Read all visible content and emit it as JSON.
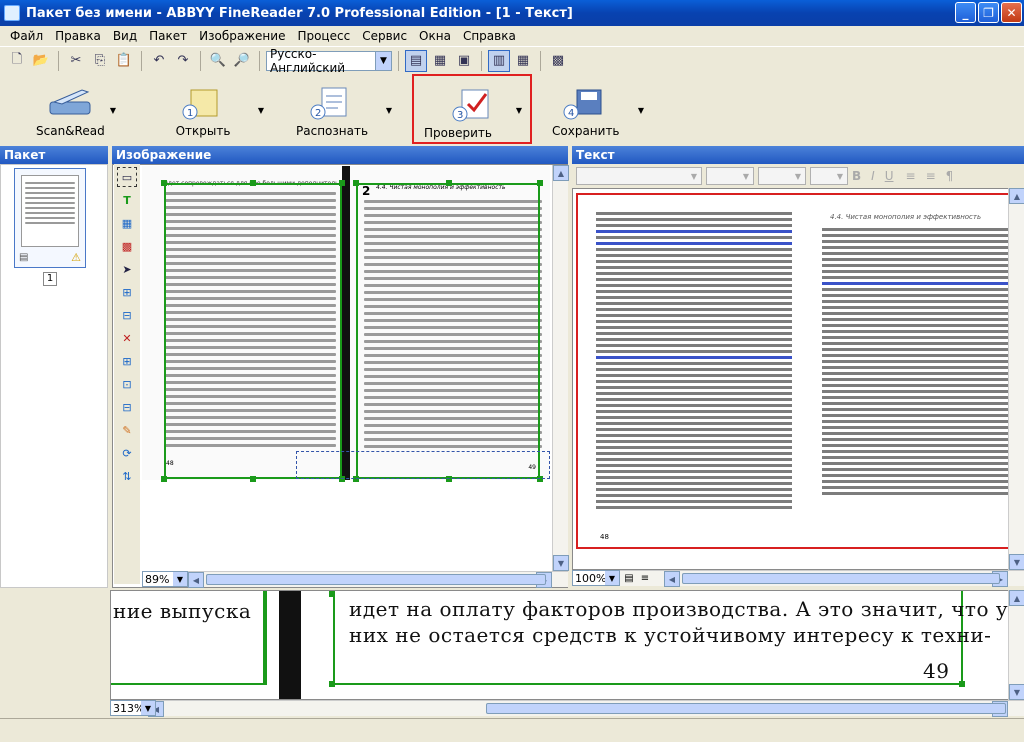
{
  "window": {
    "title": "Пакет без имени - ABBYY FineReader 7.0 Professional Edition - [1 - Текст]"
  },
  "menu": [
    "Файл",
    "Правка",
    "Вид",
    "Пакет",
    "Изображение",
    "Процесс",
    "Сервис",
    "Окна",
    "Справка"
  ],
  "toolbar": {
    "language": "Русско-Английский"
  },
  "bigbuttons": [
    {
      "label": "Scan&Read"
    },
    {
      "label": "Открыть",
      "num": "1"
    },
    {
      "label": "Распознать",
      "num": "2"
    },
    {
      "label": "Проверить",
      "num": "3"
    },
    {
      "label": "Сохранить",
      "num": "4"
    }
  ],
  "panes": {
    "batch": "Пакет",
    "image": "Изображение",
    "text": "Текст"
  },
  "thumb": {
    "page_num": "1"
  },
  "zoom": {
    "image": "89%",
    "text": "100%",
    "zoomview": "313%"
  },
  "image_pages": {
    "left_header": "идет сопровождаться для нее большими дополнительны-",
    "right_header": "4.4. Чистая монополия и эффективность",
    "right_chapter": "2",
    "left_page_num": "48",
    "right_page_num": "49"
  },
  "text_page": {
    "header": "4.4. Чистая монополия и эффективность",
    "page_num": "48"
  },
  "zoomview": {
    "left_word": "ние  выпуска",
    "line1": "идет на оплату факторов производства. А это значит, что у",
    "line2": "них не остается средств к устойчивому интересу к техни-",
    "page_num": "49"
  }
}
